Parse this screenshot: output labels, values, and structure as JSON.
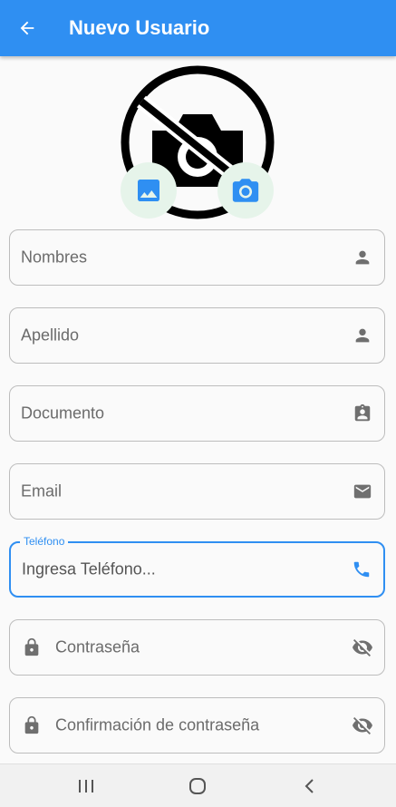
{
  "header": {
    "title": "Nuevo Usuario"
  },
  "photo": {
    "placeholder_icon": "no-photography-icon",
    "gallery_icon": "image-icon",
    "camera_icon": "camera-icon"
  },
  "form": {
    "fields": [
      {
        "label": "Nombres",
        "icon": "person-icon"
      },
      {
        "label": "Apellido",
        "icon": "person-icon"
      },
      {
        "label": "Documento",
        "icon": "badge-icon"
      },
      {
        "label": "Email",
        "icon": "email-icon"
      },
      {
        "label": "Teléfono",
        "placeholder": "Ingresa Teléfono...",
        "icon": "phone-icon"
      },
      {
        "label": "Contraseña",
        "prefix_icon": "lock-icon",
        "icon": "visibility-off-icon"
      },
      {
        "label": "Confirmación de contraseña",
        "prefix_icon": "lock-icon",
        "icon": "visibility-off-icon"
      }
    ]
  },
  "colors": {
    "primary": "#2f8ff2",
    "icon_grey": "#6f6f6f",
    "pick_bg": "#e6f4ea"
  }
}
